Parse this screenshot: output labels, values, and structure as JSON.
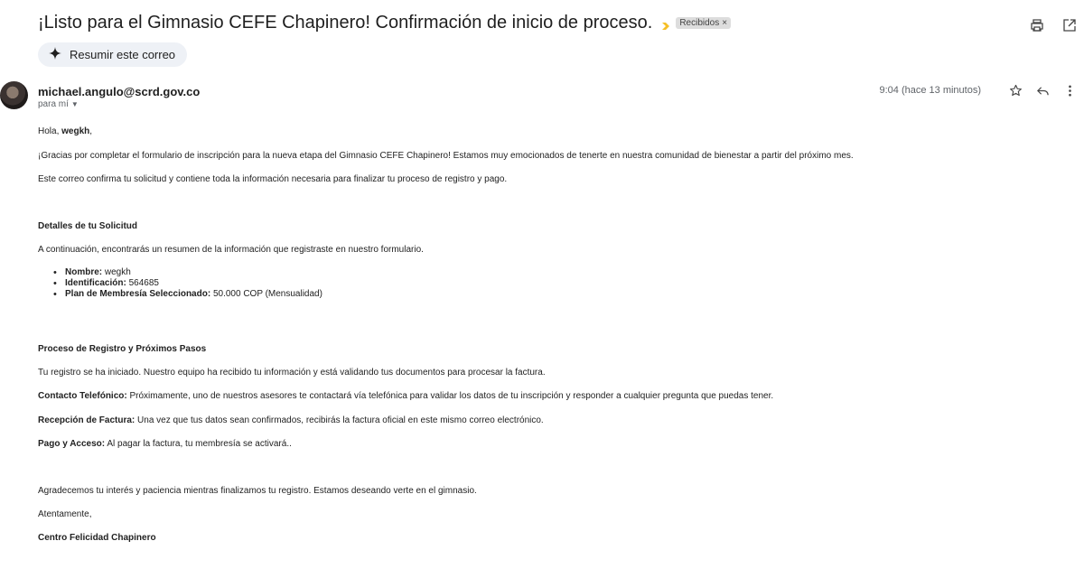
{
  "email": {
    "subject": "¡Listo para el Gimnasio CEFE Chapinero! Confirmación de inicio de proceso.",
    "label": "Recibidos",
    "label_close": "×",
    "summary_button": "Resumir este correo",
    "sender": "michael.angulo@scrd.gov.co",
    "recipient": "para mí",
    "timestamp": "9:04 (hace 13 minutos)"
  },
  "body": {
    "greeting_prefix": "Hola, ",
    "greeting_name": "wegkh",
    "greeting_suffix": ",",
    "p_thanks": "¡Gracias por completar el formulario de inscripción para la nueva etapa del Gimnasio CEFE Chapinero! Estamos muy emocionados de tenerte en nuestra comunidad de bienestar a partir del próximo mes.",
    "p_confirm": "Este correo confirma tu solicitud y contiene toda la información necesaria para finalizar tu proceso de registro y pago.",
    "heading_details": "Detalles de tu Solicitud",
    "p_summary": "A continuación, encontrarás un resumen de la información que registraste en nuestro formulario.",
    "details": [
      {
        "label": "Nombre:",
        "value": " wegkh"
      },
      {
        "label": "Identificación:",
        "value": " 564685"
      },
      {
        "label": "Plan de Membresía Seleccionado:",
        "value": " 50.000 COP (Mensualidad)"
      }
    ],
    "heading_process": "Proceso de Registro y Próximos Pasos",
    "p_started": "Tu registro se ha iniciado. Nuestro equipo ha recibido tu información y está validando tus documentos para procesar la factura.",
    "contact_label": "Contacto Telefónico:",
    "contact_text": " Próximamente, uno de nuestros asesores te contactará vía telefónica para validar los datos de tu inscripción y responder a cualquier pregunta que puedas tener.",
    "invoice_label": "Recepción de Factura:",
    "invoice_text": " Una vez que tus datos sean confirmados, recibirás la factura oficial en este mismo correo electrónico.",
    "payment_label": "Pago y Acceso:",
    "payment_text": " Al pagar la factura, tu membresía se activará..",
    "p_thanks2": "Agradecemos tu interés y paciencia mientras finalizamos tu registro. Estamos deseando verte en el gimnasio.",
    "closing": "Atentamente,",
    "signature": "Centro Felicidad Chapinero"
  },
  "icons": {
    "importance": "importance-marker-icon",
    "print": "print-icon",
    "open_new_window": "open-in-new-window-icon",
    "sparkle": "sparkle-icon",
    "star": "star-icon",
    "reply": "reply-icon",
    "more": "more-vertical-icon"
  },
  "colors": {
    "importance_marker": "#f6bf26",
    "label_chip_bg": "#dddddd",
    "summary_bg": "#eef1f6"
  }
}
